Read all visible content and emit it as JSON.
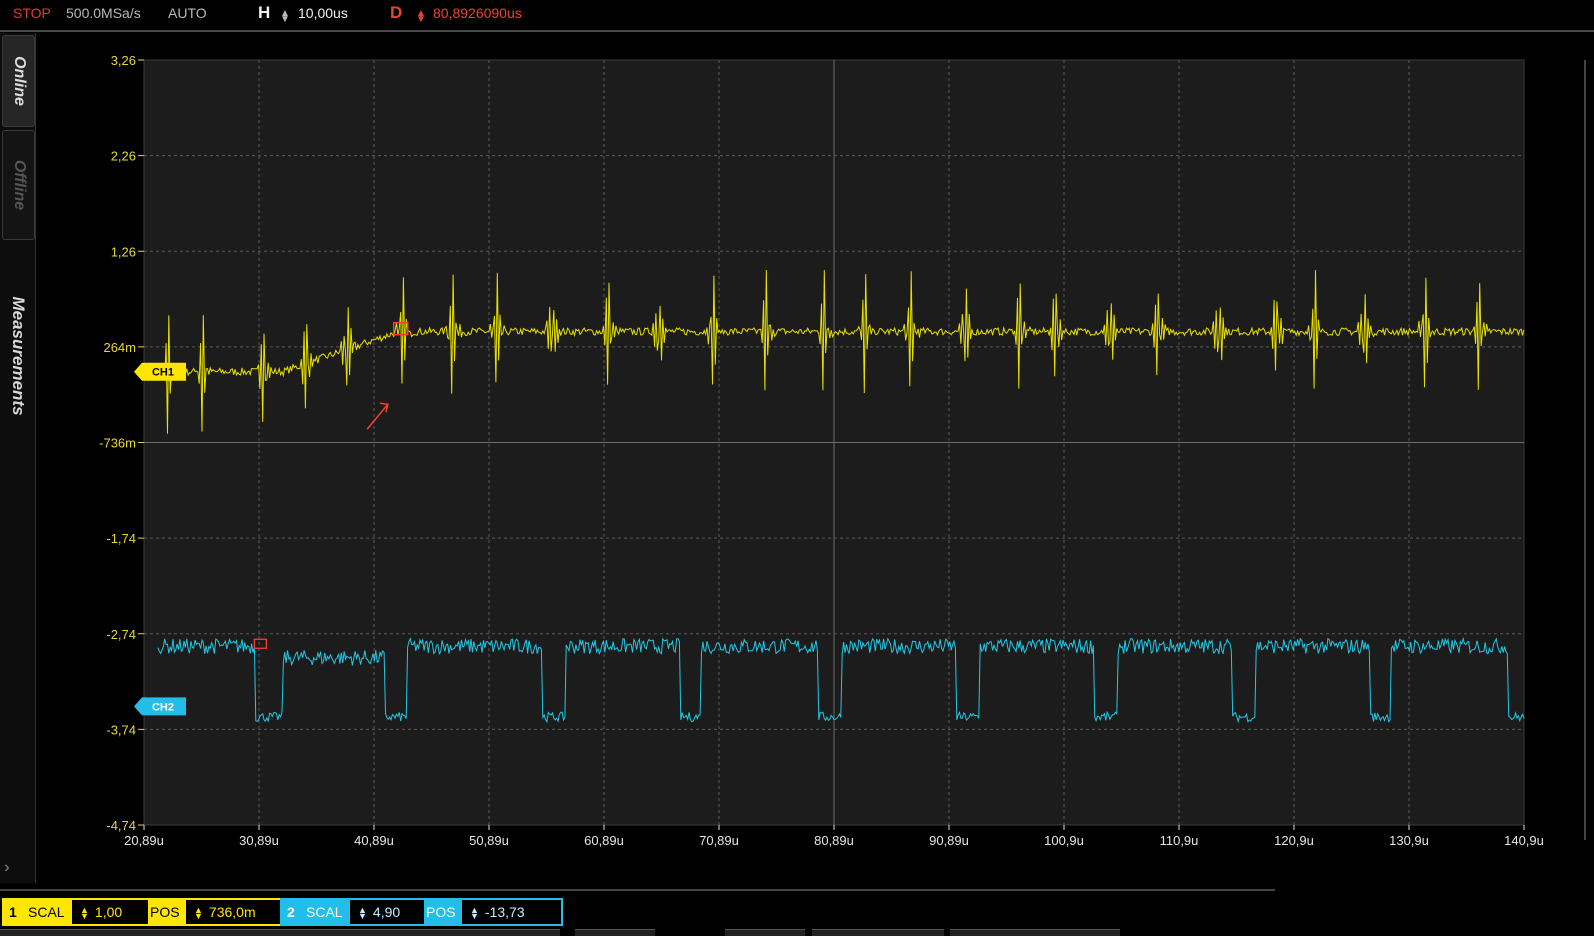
{
  "topbar": {
    "status": "STOP",
    "sample_rate": "500.0MSa/s",
    "trigger_mode": "AUTO",
    "h_label": "H",
    "h_value": "10,00us",
    "d_label": "D",
    "d_value": "80,8926090us"
  },
  "sidebar": {
    "tabs": [
      {
        "label": "Online"
      },
      {
        "label": "Offline"
      },
      {
        "label": "Measurements"
      }
    ]
  },
  "chart_data": {
    "type": "line",
    "x_tick_labels": [
      "20,89u",
      "30,89u",
      "40,89u",
      "50,89u",
      "60,89u",
      "70,89u",
      "80,89u",
      "90,89u",
      "100,9u",
      "110,9u",
      "120,9u",
      "130,9u",
      "140,9u"
    ],
    "y_tick_labels": [
      "3,26",
      "2,26",
      "1,26",
      "264m",
      "-736m",
      "-1,74",
      "-2,74",
      "-3,74",
      "-4,74"
    ],
    "xlim": [
      20.89,
      140.9
    ],
    "ylim": [
      -4.74,
      3.26
    ],
    "grid": true,
    "series": [
      {
        "name": "CH1",
        "color": "#e8e000",
        "baseline_start": 0.0,
        "baseline_end": 0.42,
        "spike_max": 1.3,
        "spike_min": -0.85
      },
      {
        "name": "CH2",
        "color": "#22c8e6",
        "high": -2.87,
        "low": -3.61
      }
    ],
    "markers": [
      {
        "label": "CH1",
        "color": "#ffe600",
        "y": 0.0
      },
      {
        "label": "CH2",
        "color": "#22bde8",
        "y": -3.5
      }
    ]
  },
  "channels": {
    "ch1": {
      "num": "1",
      "scal_label": "SCAL",
      "scal_value": "1,00",
      "pos_label": "POS",
      "pos_value": "736,0m",
      "color": "#ffe600"
    },
    "ch2": {
      "num": "2",
      "scal_label": "SCAL",
      "scal_value": "4,90",
      "pos_label": "POS",
      "pos_value": "-13,73",
      "color": "#22bde8"
    }
  }
}
